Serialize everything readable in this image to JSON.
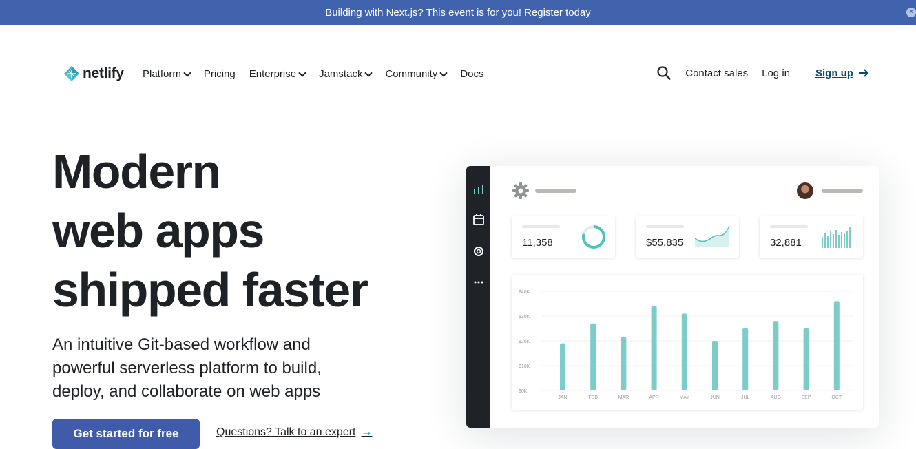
{
  "banner": {
    "text": "Building with Next.js? This event is for you!",
    "link": "Register today",
    "close_icon": "close-icon"
  },
  "nav": {
    "logo_text": "netlify",
    "links": [
      {
        "label": "Platform",
        "dropdown": true
      },
      {
        "label": "Pricing",
        "dropdown": false
      },
      {
        "label": "Enterprise",
        "dropdown": true
      },
      {
        "label": "Jamstack",
        "dropdown": true
      },
      {
        "label": "Community",
        "dropdown": true
      },
      {
        "label": "Docs",
        "dropdown": false
      }
    ],
    "contact_sales": "Contact sales",
    "log_in": "Log in",
    "sign_up": "Sign up"
  },
  "hero": {
    "title_line1": "Modern",
    "title_line2": "web apps",
    "title_line3": "shipped faster",
    "subtitle": "An intuitive Git-based workflow and powerful serverless platform to build, deploy, and collaborate on web apps",
    "cta": "Get started for free",
    "expert_link": "Questions? Talk to an expert"
  },
  "dashboard": {
    "stats": [
      {
        "value": "11,358",
        "graphic": "donut"
      },
      {
        "value": "$55,835",
        "graphic": "area"
      },
      {
        "value": "32,881",
        "graphic": "bars"
      }
    ],
    "side_icons": [
      "bar-chart-icon",
      "calendar-icon",
      "lifebuoy-icon",
      "more-dots-icon"
    ]
  },
  "colors": {
    "banner": "#4163ad",
    "cta": "#3f5ba9",
    "teal": "#7ccdca",
    "dark": "#1e2125"
  },
  "chart_data": {
    "type": "bar",
    "categories": [
      "JAN",
      "FEB",
      "MAR",
      "APR",
      "MAY",
      "JUN",
      "JUL",
      "AUG",
      "SEP",
      "OCT"
    ],
    "values": [
      19000,
      27000,
      21500,
      34000,
      31000,
      20000,
      25000,
      28000,
      25000,
      36000
    ],
    "yticks": [
      "$0K",
      "$10K",
      "$20K",
      "$30K",
      "$40K"
    ],
    "ylim": [
      0,
      40000
    ]
  }
}
